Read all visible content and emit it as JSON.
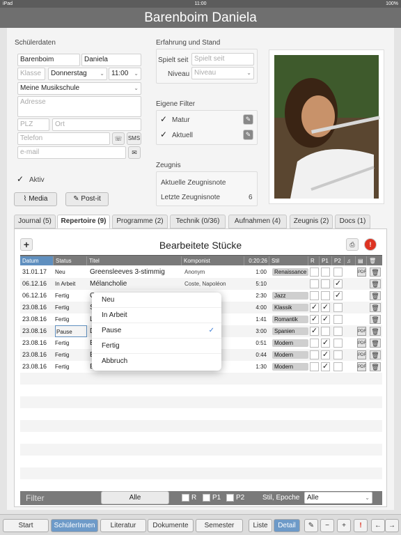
{
  "statusbar": {
    "device": "iPad",
    "time": "11:00",
    "battery": "100%"
  },
  "title": "Barenboim Daniela",
  "student": {
    "section": "Schülerdaten",
    "lastname": "Barenboim",
    "firstname": "Daniela",
    "class_ph": "Klasse",
    "day": "Donnerstag",
    "time": "11:00",
    "school": "Meine Musikschule",
    "address_ph": "Adresse",
    "zip_ph": "PLZ",
    "city_ph": "Ort",
    "phone_ph": "Telefon",
    "sms": "SMS",
    "email_ph": "e-mail",
    "active_label": "Aktiv"
  },
  "experience": {
    "section": "Erfahrung und Stand",
    "plays_since_label": "Spielt seit",
    "plays_since_ph": "Spielt seit",
    "level_label": "Niveau",
    "level_ph": "Niveau"
  },
  "filters": {
    "section": "Eigene Filter",
    "items": [
      "Matur",
      "Aktuell"
    ]
  },
  "report": {
    "section": "Zeugnis",
    "current": "Aktuelle Zeugnisnote",
    "last": "Letzte Zeugnisnote",
    "last_value": "6"
  },
  "buttons": {
    "media": "Media",
    "postit": "Post-it"
  },
  "tabs": [
    "Journal (5)",
    "Repertoire (9)",
    "Programme (2)",
    "Technik (0/36)",
    "Aufnahmen (4)",
    "Zeugnis (2)",
    "Docs (1)"
  ],
  "panel": {
    "title": "Bearbeitete Stücke",
    "add": "+"
  },
  "columns": [
    "Datum",
    "Status",
    "Titel",
    "Komponist",
    "0:20:26",
    "Stil",
    "R",
    "P1",
    "P2"
  ],
  "rows": [
    {
      "date": "31.01.17",
      "status": "Neu",
      "title": "Greensleeves 3-stimmig",
      "composer": "Anonym",
      "dur": "1:00",
      "stil": "Renaissance",
      "r": "",
      "p1": "",
      "p2": "",
      "pdf": "PDF"
    },
    {
      "date": "06.12.16",
      "status": "In Arbeit",
      "title": "Mélancholie",
      "composer": "Coste, Napoléon",
      "dur": "5:10",
      "stil": "",
      "r": "",
      "p1": "",
      "p2": "✓",
      "pdf": ""
    },
    {
      "date": "06.12.16",
      "status": "Fertig",
      "title": "Gr",
      "composer": "",
      "dur": "2:30",
      "stil": "Jazz",
      "r": "",
      "p1": "",
      "p2": "✓",
      "pdf": ""
    },
    {
      "date": "23.08.16",
      "status": "Fertig",
      "title": "Sc",
      "composer": "dwig van",
      "dur": "4:00",
      "stil": "Klassik",
      "r": "✓",
      "p1": "✓",
      "p2": "",
      "pdf": ""
    },
    {
      "date": "23.08.16",
      "status": "Fertig",
      "title": "La",
      "composer": "sco",
      "dur": "1:41",
      "stil": "Romantik",
      "r": "✓",
      "p1": "✓",
      "p2": "",
      "pdf": ""
    },
    {
      "date": "23.08.16",
      "status": "Pause",
      "title": "D",
      "composer": "tolomé",
      "dur": "3:00",
      "stil": "Spanien",
      "r": "✓",
      "p1": "",
      "p2": "",
      "pdf": "PDF"
    },
    {
      "date": "23.08.16",
      "status": "Fertig",
      "title": "Et",
      "composer": "",
      "dur": "0:51",
      "stil": "Modern",
      "r": "",
      "p1": "✓",
      "p2": "",
      "pdf": "PDF"
    },
    {
      "date": "23.08.16",
      "status": "Fertig",
      "title": "Et",
      "composer": "",
      "dur": "0:44",
      "stil": "Modern",
      "r": "",
      "p1": "✓",
      "p2": "",
      "pdf": "PDF"
    },
    {
      "date": "23.08.16",
      "status": "Fertig",
      "title": "Et",
      "composer": "",
      "dur": "1:30",
      "stil": "Modern",
      "r": "",
      "p1": "✓",
      "p2": "",
      "pdf": "PDF"
    }
  ],
  "popup": {
    "items": [
      "Neu",
      "In Arbeit",
      "Pause",
      "Fertig",
      "Abbruch"
    ],
    "selected": "Pause"
  },
  "filterbar": {
    "label": "Filter",
    "all": "Alle",
    "r": "R",
    "p1": "P1",
    "p2": "P2",
    "stil_label": "Stil, Epoche",
    "stil_value": "Alle"
  },
  "bottom": [
    "Start",
    "SchülerInnen",
    "Literatur",
    "Dokumente",
    "Semester",
    "Liste",
    "Detail"
  ]
}
